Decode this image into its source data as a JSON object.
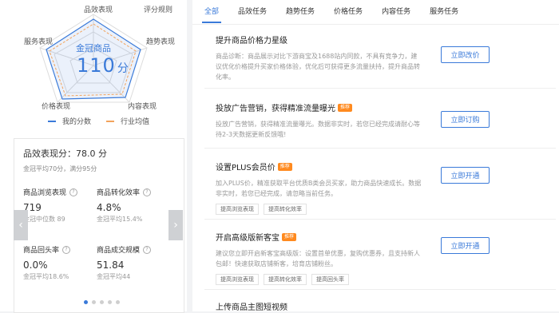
{
  "radar": {
    "title": "金冠商品",
    "score": "110",
    "score_unit": "分",
    "axes": {
      "effect": "品效表现",
      "rules": "评分规则",
      "trend": "趋势表现",
      "content": "内容表现",
      "price": "价格表现",
      "service": "服务表现"
    },
    "legend": {
      "mine": "我的分数",
      "avg": "行业均值"
    },
    "colors": {
      "mine": "#3a7ad9",
      "avg": "#f2a35c"
    }
  },
  "stats": {
    "title": "品效表现分：78.0 分",
    "subtitle": "金冠平均70分，满分95分",
    "metrics": [
      {
        "name": "商品浏览表现",
        "value": "719",
        "ref": "金冠中位数 89"
      },
      {
        "name": "商品转化效率",
        "value": "4.8%",
        "ref": "金冠平均15.4%"
      },
      {
        "name": "商品回头率",
        "value": "0.0%",
        "ref": "金冠平均18.6%"
      },
      {
        "name": "商品成交规模",
        "value": "51.84",
        "ref": "金冠平均44"
      }
    ],
    "prev_arrow": "‹",
    "next_arrow": "›",
    "page_dots": 5,
    "active_dot": 1
  },
  "tabs": [
    "全部",
    "品效任务",
    "趋势任务",
    "价格任务",
    "内容任务",
    "服务任务"
  ],
  "tasks": [
    {
      "title": "提升商品价格力星级",
      "badge": "",
      "desc": "商品诊断：商品展示对比下游商宝及1688站内同款，不具有竞争力，建议优化价格提升买家价格体验，优化后可获得更多流量扶持，提升商品转化率。",
      "tags": [],
      "button": "立即改价"
    },
    {
      "title": "投放广告营销，获得精准流量曝光",
      "badge": "推荐",
      "desc": "投放广告营销，获得精准流量曝光。数据非实时，若您已经完成请耐心等待2-3天数据更新反馈哦!",
      "tags": [],
      "button": "立即订购"
    },
    {
      "title": "设置PLUS会员价",
      "badge": "推荐",
      "desc": "加入PLUS价，精准获取平台优质B类会员买家，助力商品快速成长。数据非实时，若您已经完成，请忽略当前任务。",
      "tags": [
        "提高浏览表现",
        "提高转化效率"
      ],
      "button": "立即开通"
    },
    {
      "title": "开启高级版新客宝",
      "badge": "推荐",
      "desc": "建议您立即开启新客宝高级版：设置首单优惠，复购优惠券，且支持新人包邮！快速获取店铺新客，培育店铺粉丝。",
      "tags": [
        "提高浏览表现",
        "提高转化效率",
        "提高回头率"
      ],
      "button": "立即开通"
    },
    {
      "title": "上传商品主图短视频",
      "badge": "",
      "desc": "",
      "tags": [],
      "button": ""
    }
  ]
}
